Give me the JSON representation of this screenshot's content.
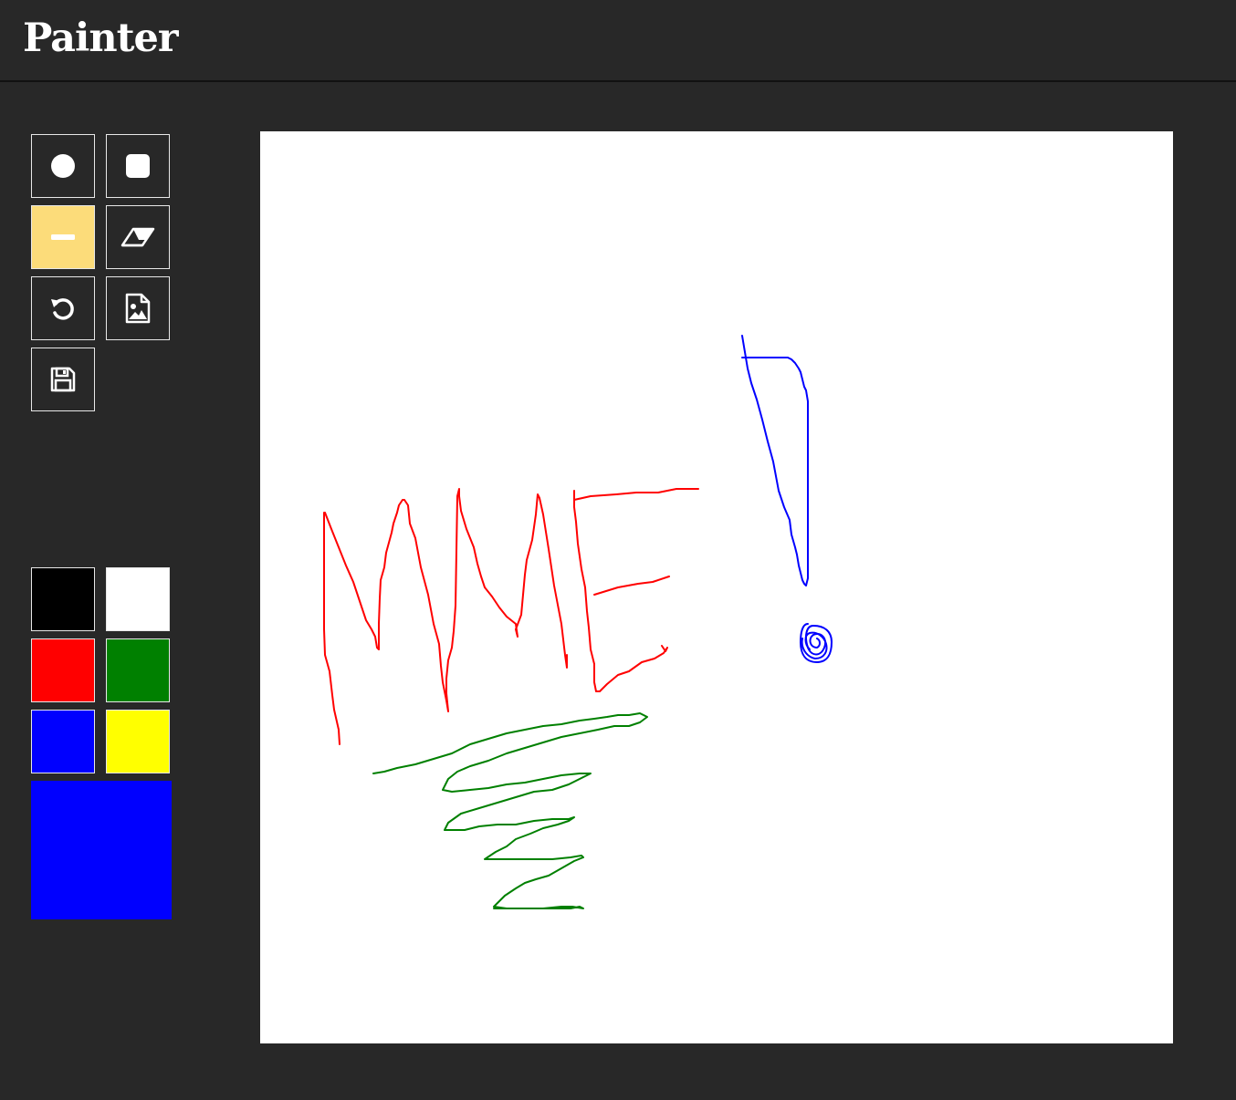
{
  "app": {
    "title": "Painter"
  },
  "toolbar": {
    "tools": [
      {
        "id": "brush-round",
        "icon": "circle-brush-icon",
        "active": false
      },
      {
        "id": "brush-square",
        "icon": "square-brush-icon",
        "active": false
      },
      {
        "id": "brush-line",
        "icon": "line-brush-icon",
        "active": true
      },
      {
        "id": "eraser",
        "icon": "eraser-icon",
        "active": false
      },
      {
        "id": "undo",
        "icon": "undo-icon",
        "active": false
      },
      {
        "id": "open-image",
        "icon": "image-file-icon",
        "active": false
      },
      {
        "id": "save",
        "icon": "floppy-disk-icon",
        "active": false
      }
    ],
    "active_color": "#fcdc7a"
  },
  "palette": {
    "swatches": [
      {
        "name": "black",
        "color": "#000000"
      },
      {
        "name": "white",
        "color": "#ffffff"
      },
      {
        "name": "red",
        "color": "#ff0000"
      },
      {
        "name": "green",
        "color": "#008000"
      },
      {
        "name": "blue",
        "color": "#0000ff"
      },
      {
        "name": "yellow",
        "color": "#ffff00"
      }
    ],
    "current_color": "#0000ff"
  },
  "canvas": {
    "background": "#ffffff",
    "stroke_colors": {
      "red": "#ff0000",
      "blue": "#0000ff",
      "green": "#008000"
    }
  }
}
